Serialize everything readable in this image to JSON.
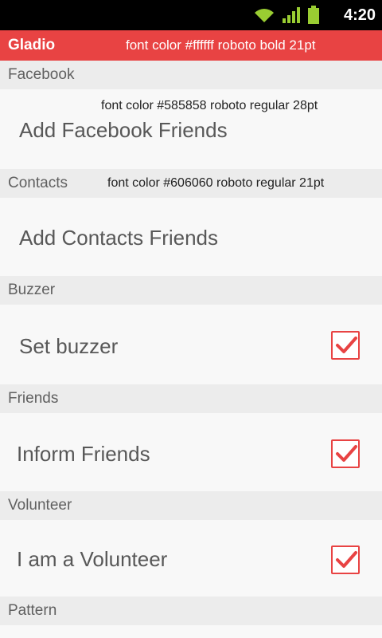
{
  "status_bar": {
    "time": "4:20",
    "icons": [
      "wifi-icon",
      "signal-icon",
      "battery-icon"
    ]
  },
  "action_bar": {
    "title": "Gladio",
    "annotation": "font color  #ffffff  roboto bold 21pt",
    "color": "#e84343"
  },
  "sections": [
    {
      "header": "Facebook",
      "item": {
        "label": "Add Facebook Friends",
        "annotation": "font color  #585858 roboto regular 28pt"
      }
    },
    {
      "header": "Contacts",
      "header_annotation": "font color  #606060  roboto regular 21pt",
      "item": {
        "label": "Add Contacts Friends"
      }
    },
    {
      "header": "Buzzer",
      "item": {
        "label": "Set buzzer",
        "checked": true
      }
    },
    {
      "header": "Friends",
      "item": {
        "label": "Inform Friends",
        "checked": true
      }
    },
    {
      "header": "Volunteer",
      "item": {
        "label": "I am a Volunteer",
        "checked": true
      }
    },
    {
      "header": "Pattern"
    }
  ]
}
